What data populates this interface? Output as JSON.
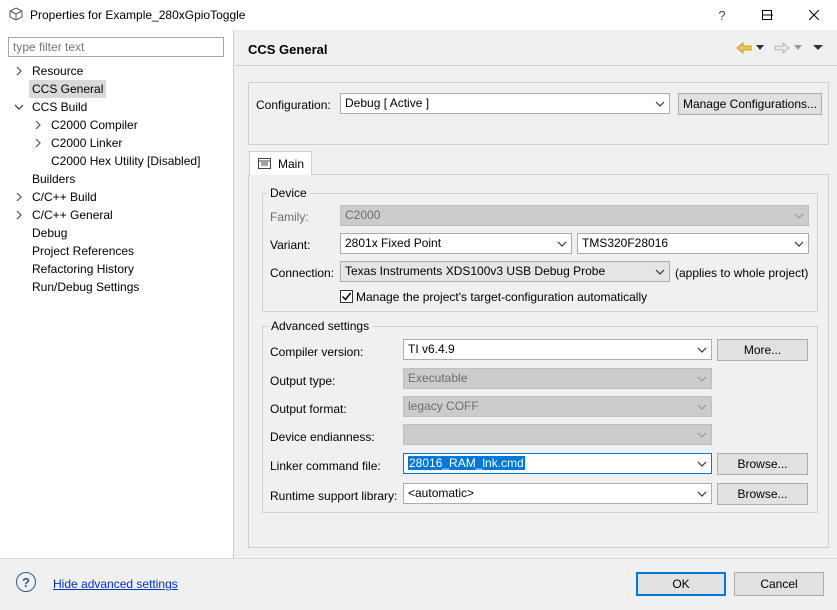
{
  "window": {
    "title": "Properties for Example_280xGpioToggle",
    "icons": [
      "app-icon",
      "help-icon",
      "minimize-icon",
      "maximize-icon",
      "close-icon"
    ]
  },
  "filter": {
    "placeholder": "type filter text"
  },
  "tree": [
    {
      "label": "Resource",
      "twisty": "right"
    },
    {
      "label": "CCS General",
      "twisty": "none"
    },
    {
      "label": "CCS Build",
      "twisty": "down"
    },
    {
      "label": "C2000 Compiler",
      "twisty": "right"
    },
    {
      "label": "C2000 Linker",
      "twisty": "right"
    },
    {
      "label": "C2000 Hex Utility  [Disabled]",
      "twisty": "none"
    },
    {
      "label": "Builders",
      "twisty": "none"
    },
    {
      "label": "C/C++ Build",
      "twisty": "right"
    },
    {
      "label": "C/C++ General",
      "twisty": "right"
    },
    {
      "label": "Debug",
      "twisty": "none"
    },
    {
      "label": "Project References",
      "twisty": "none"
    },
    {
      "label": "Refactoring History",
      "twisty": "none"
    },
    {
      "label": "Run/Debug Settings",
      "twisty": "none"
    }
  ],
  "page": {
    "title": "CCS General"
  },
  "configuration": {
    "label": "Configuration:",
    "value": "Debug  [ Active ]",
    "manage_button": "Manage Configurations..."
  },
  "tabs": {
    "main": "Main"
  },
  "device": {
    "group_label": "Device",
    "family_label": "Family:",
    "family_value": "C2000",
    "variant_label": "Variant:",
    "variant_filter": "2801x Fixed Point",
    "variant_value": "TMS320F28016",
    "connection_label": "Connection:",
    "connection_value": "Texas Instruments XDS100v3 USB Debug Probe",
    "connection_note": "(applies to whole project)",
    "manage_target_label": "Manage the project's target-configuration automatically",
    "manage_target_checked": "true"
  },
  "advanced": {
    "group_label": "Advanced settings",
    "compiler_label": "Compiler version:",
    "compiler_value": "TI v6.4.9",
    "more_button": "More...",
    "output_type_label": "Output type:",
    "output_type_value": "Executable",
    "output_format_label": "Output format:",
    "output_format_value": "legacy COFF",
    "endianness_label": "Device endianness:",
    "endianness_value": "",
    "linker_label": "Linker command file:",
    "linker_value": "28016_RAM_lnk.cmd",
    "runtime_label": "Runtime support library:",
    "runtime_value": "<automatic>",
    "browse_button": "Browse..."
  },
  "footer": {
    "help_glyph": "?",
    "hide_link": "Hide advanced settings",
    "ok_button": "OK",
    "cancel_button": "Cancel"
  },
  "colors": {
    "accent": "#0078d7",
    "link": "#0033cc",
    "disabled_bg": "#cccccc"
  }
}
